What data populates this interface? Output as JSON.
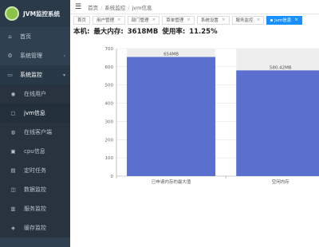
{
  "app": {
    "title": "JVM监控系统"
  },
  "sidebar": {
    "items": [
      {
        "icon": "home-icon",
        "glyph": "⌂",
        "label": "首页",
        "has_arrow": false
      },
      {
        "icon": "gear-icon",
        "glyph": "⚙",
        "label": "系统管理",
        "has_arrow": true
      },
      {
        "icon": "monitor-icon",
        "glyph": "▭",
        "label": "系统监控",
        "has_arrow": true,
        "open": true
      }
    ],
    "submenu": [
      {
        "icon": "user-icon",
        "glyph": "◉",
        "label": "在线用户"
      },
      {
        "icon": "jvm-icon",
        "glyph": "▢",
        "label": "jvm信息",
        "active": true
      },
      {
        "icon": "server-icon",
        "glyph": "◍",
        "label": "在线客户端"
      },
      {
        "icon": "cpu-icon",
        "glyph": "▣",
        "label": "cpu信息"
      },
      {
        "icon": "task-icon",
        "glyph": "▤",
        "label": "定时任务"
      },
      {
        "icon": "database-icon",
        "glyph": "◫",
        "label": "数据监控"
      },
      {
        "icon": "cache-icon",
        "glyph": "▥",
        "label": "服务监控"
      },
      {
        "icon": "cache-monitor-icon",
        "glyph": "◈",
        "label": "缓存监控"
      }
    ]
  },
  "header": {
    "breadcrumb": [
      "首页",
      "系统监控",
      "jvm信息"
    ]
  },
  "tabs": [
    {
      "label": "首页",
      "closable": false
    },
    {
      "label": "用户管理",
      "closable": true
    },
    {
      "label": "部门管理",
      "closable": true
    },
    {
      "label": "菜单管理",
      "closable": true
    },
    {
      "label": "系统设置",
      "closable": true
    },
    {
      "label": "服务监控",
      "closable": true
    },
    {
      "label": "jvm信息",
      "closable": true,
      "active": true
    }
  ],
  "summary": {
    "host_label": "本机:",
    "max_mem_label": "最大内存:",
    "max_mem_value": "3618MB",
    "usage_label": "使用率:",
    "usage_value": "11.25%"
  },
  "chart_data": {
    "type": "bar",
    "categories": [
      "已申请内存的最大值",
      "空闲内存"
    ],
    "values": [
      654,
      580.42
    ],
    "data_labels": [
      "654MB",
      "580.42MB"
    ],
    "ylim": [
      0,
      700
    ],
    "yticks": [
      0,
      100,
      200,
      300,
      400,
      500,
      600,
      700
    ],
    "bar_color": "#5b6fcf",
    "background_bar_color": "#eeeeee",
    "grid": true
  }
}
